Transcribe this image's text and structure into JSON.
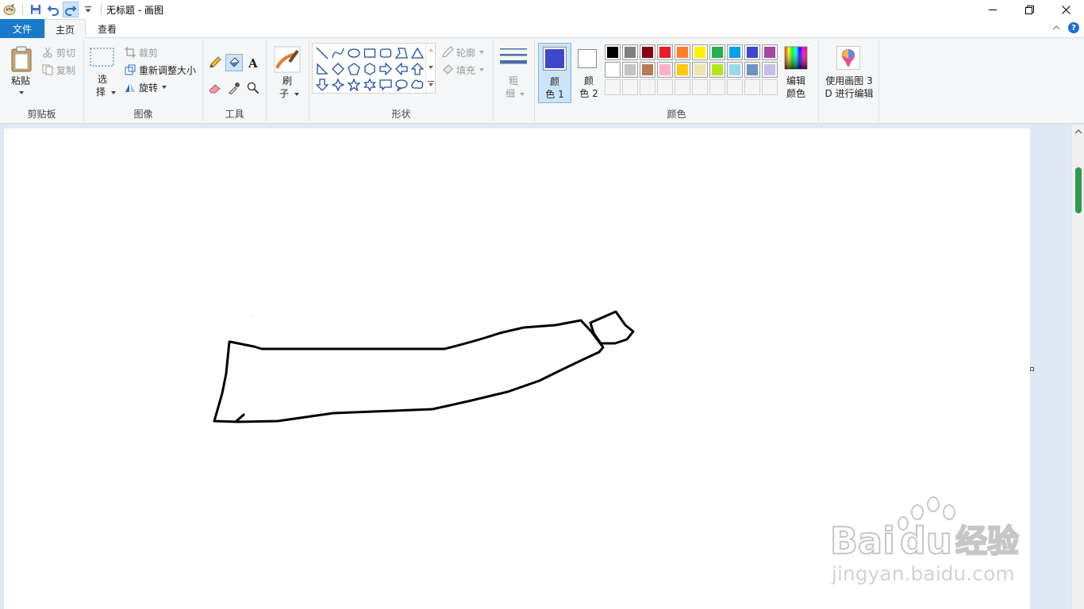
{
  "titlebar": {
    "title": "无标题 - 画图",
    "icons": [
      "paint-app-icon",
      "save-icon",
      "undo-icon",
      "redo-icon",
      "customize-qat-icon"
    ],
    "window_controls": [
      "minimize-icon",
      "restore-icon",
      "close-icon"
    ]
  },
  "tabs": {
    "file": "文件",
    "home": "主页",
    "view": "查看"
  },
  "clipboard": {
    "paste": "粘贴",
    "cut": "剪切",
    "copy": "复制",
    "label": "剪贴板"
  },
  "image": {
    "select_line1": "选",
    "select_line2": "择",
    "crop": "裁剪",
    "resize": "重新调整大小",
    "rotate": "旋转",
    "label": "图像"
  },
  "tools": {
    "label": "工具",
    "icons": [
      "pencil-icon",
      "fill-icon",
      "text-icon",
      "eraser-icon",
      "color-picker-icon",
      "magnifier-icon"
    ]
  },
  "brushes": {
    "line1": "刷",
    "line2": "子"
  },
  "shapes": {
    "label": "形状",
    "outline": "轮廓",
    "fill": "填充"
  },
  "size": {
    "line1": "粗",
    "line2": "细"
  },
  "colors": {
    "color1_line1": "颜",
    "color1_line2": "色 1",
    "color2_line1": "颜",
    "color2_line2": "色 2",
    "edit_line1": "编辑",
    "edit_line2": "颜色",
    "label": "颜色",
    "color1_value": "#3f48cc",
    "color2_value": "#ffffff",
    "palette_row1": [
      "#000000",
      "#7f7f7f",
      "#880015",
      "#ed1c24",
      "#ff7f27",
      "#fff200",
      "#22b14c",
      "#00a2e8",
      "#3f48cc",
      "#a349a4"
    ],
    "palette_row2": [
      "#ffffff",
      "#c3c3c3",
      "#b97a57",
      "#ffaec9",
      "#ffc90e",
      "#efe4b0",
      "#b5e61d",
      "#99d9ea",
      "#7092be",
      "#c8bfe7"
    ],
    "palette_row3": [
      "#f5f5f5",
      "#f5f5f5",
      "#f5f5f5",
      "#f5f5f5",
      "#f5f5f5",
      "#f5f5f5",
      "#f5f5f5",
      "#f5f5f5",
      "#f5f5f5",
      "#f5f5f5"
    ]
  },
  "paint3d": {
    "line1": "使用画图 3",
    "line2": "D 进行编辑"
  },
  "watermark": {
    "brand": "Bai",
    "brand2": "du",
    "cn": "经验",
    "url": "jingyan.baidu.com"
  }
}
